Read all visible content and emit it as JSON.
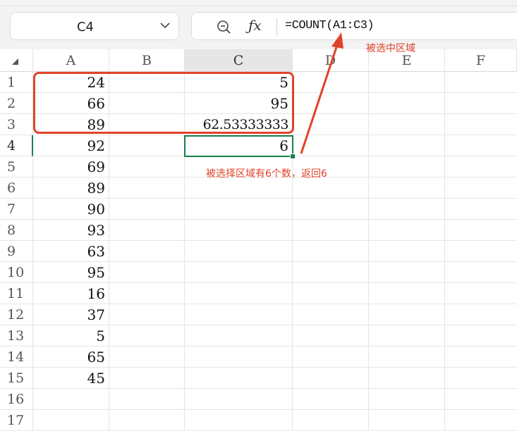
{
  "namebox": {
    "value": "C4"
  },
  "formula_bar": {
    "formula": "=COUNT(A1:C3)"
  },
  "columns": [
    "A",
    "B",
    "C",
    "D",
    "E",
    "F"
  ],
  "active_column": "C",
  "rows": [
    "1",
    "2",
    "3",
    "4",
    "5",
    "6",
    "7",
    "8",
    "9",
    "10",
    "11",
    "12",
    "13",
    "14",
    "15",
    "16",
    "17"
  ],
  "active_row": "4",
  "cells": {
    "A": [
      "24",
      "66",
      "89",
      "92",
      "69",
      "89",
      "90",
      "93",
      "63",
      "95",
      "16",
      "37",
      "5",
      "65",
      "45"
    ],
    "C": [
      "5",
      "95",
      "62.53333333",
      "6"
    ]
  },
  "annotations": {
    "range_note": "被选中区域",
    "result_note": "被选择区域有6个数，返回6"
  },
  "colors": {
    "accent_green": "#1a7f4b",
    "annotation_red": "#e0432a"
  }
}
